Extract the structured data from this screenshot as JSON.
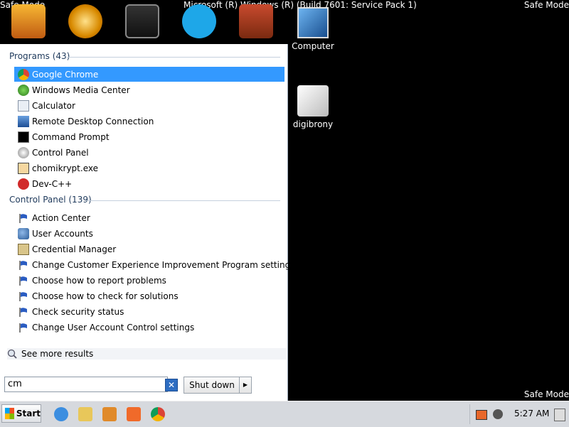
{
  "desktop": {
    "safe_mode_label": "Safe Mode",
    "build_text": "Microsoft (R) Windows (R) (Build 7601: Service Pack 1)",
    "icons": [
      {
        "label": "Computer"
      },
      {
        "label": "digibrony"
      }
    ]
  },
  "start_menu": {
    "programs_header": "Programs (43)",
    "programs": [
      {
        "label": "Google Chrome",
        "icon": "chrome-icon"
      },
      {
        "label": "Windows Media Center",
        "icon": "media-center-icon"
      },
      {
        "label": "Calculator",
        "icon": "calculator-icon"
      },
      {
        "label": "Remote Desktop Connection",
        "icon": "remote-desktop-icon"
      },
      {
        "label": "Command Prompt",
        "icon": "command-prompt-icon"
      },
      {
        "label": "Control Panel",
        "icon": "control-panel-icon"
      },
      {
        "label": "chomikrypt.exe",
        "icon": "chomikrypt-icon"
      },
      {
        "label": "Dev-C++",
        "icon": "devcpp-icon"
      }
    ],
    "control_panel_header": "Control Panel (139)",
    "control_panel_items": [
      {
        "label": "Action Center",
        "icon": "flag-icon"
      },
      {
        "label": "User Accounts",
        "icon": "users-icon"
      },
      {
        "label": "Credential Manager",
        "icon": "credential-icon"
      },
      {
        "label": "Change Customer Experience Improvement Program settings",
        "icon": "flag-icon"
      },
      {
        "label": "Choose how to report problems",
        "icon": "flag-icon"
      },
      {
        "label": "Choose how to check for solutions",
        "icon": "flag-icon"
      },
      {
        "label": "Check security status",
        "icon": "flag-icon"
      },
      {
        "label": "Change User Account Control settings",
        "icon": "flag-icon"
      }
    ],
    "see_more": "See more results",
    "search_value": "cm",
    "shutdown_label": "Shut down"
  },
  "taskbar": {
    "start_label": "Start",
    "clock": "5:27 AM"
  },
  "colors": {
    "selection": "#3399ff",
    "taskbar": "#d6d9de"
  }
}
